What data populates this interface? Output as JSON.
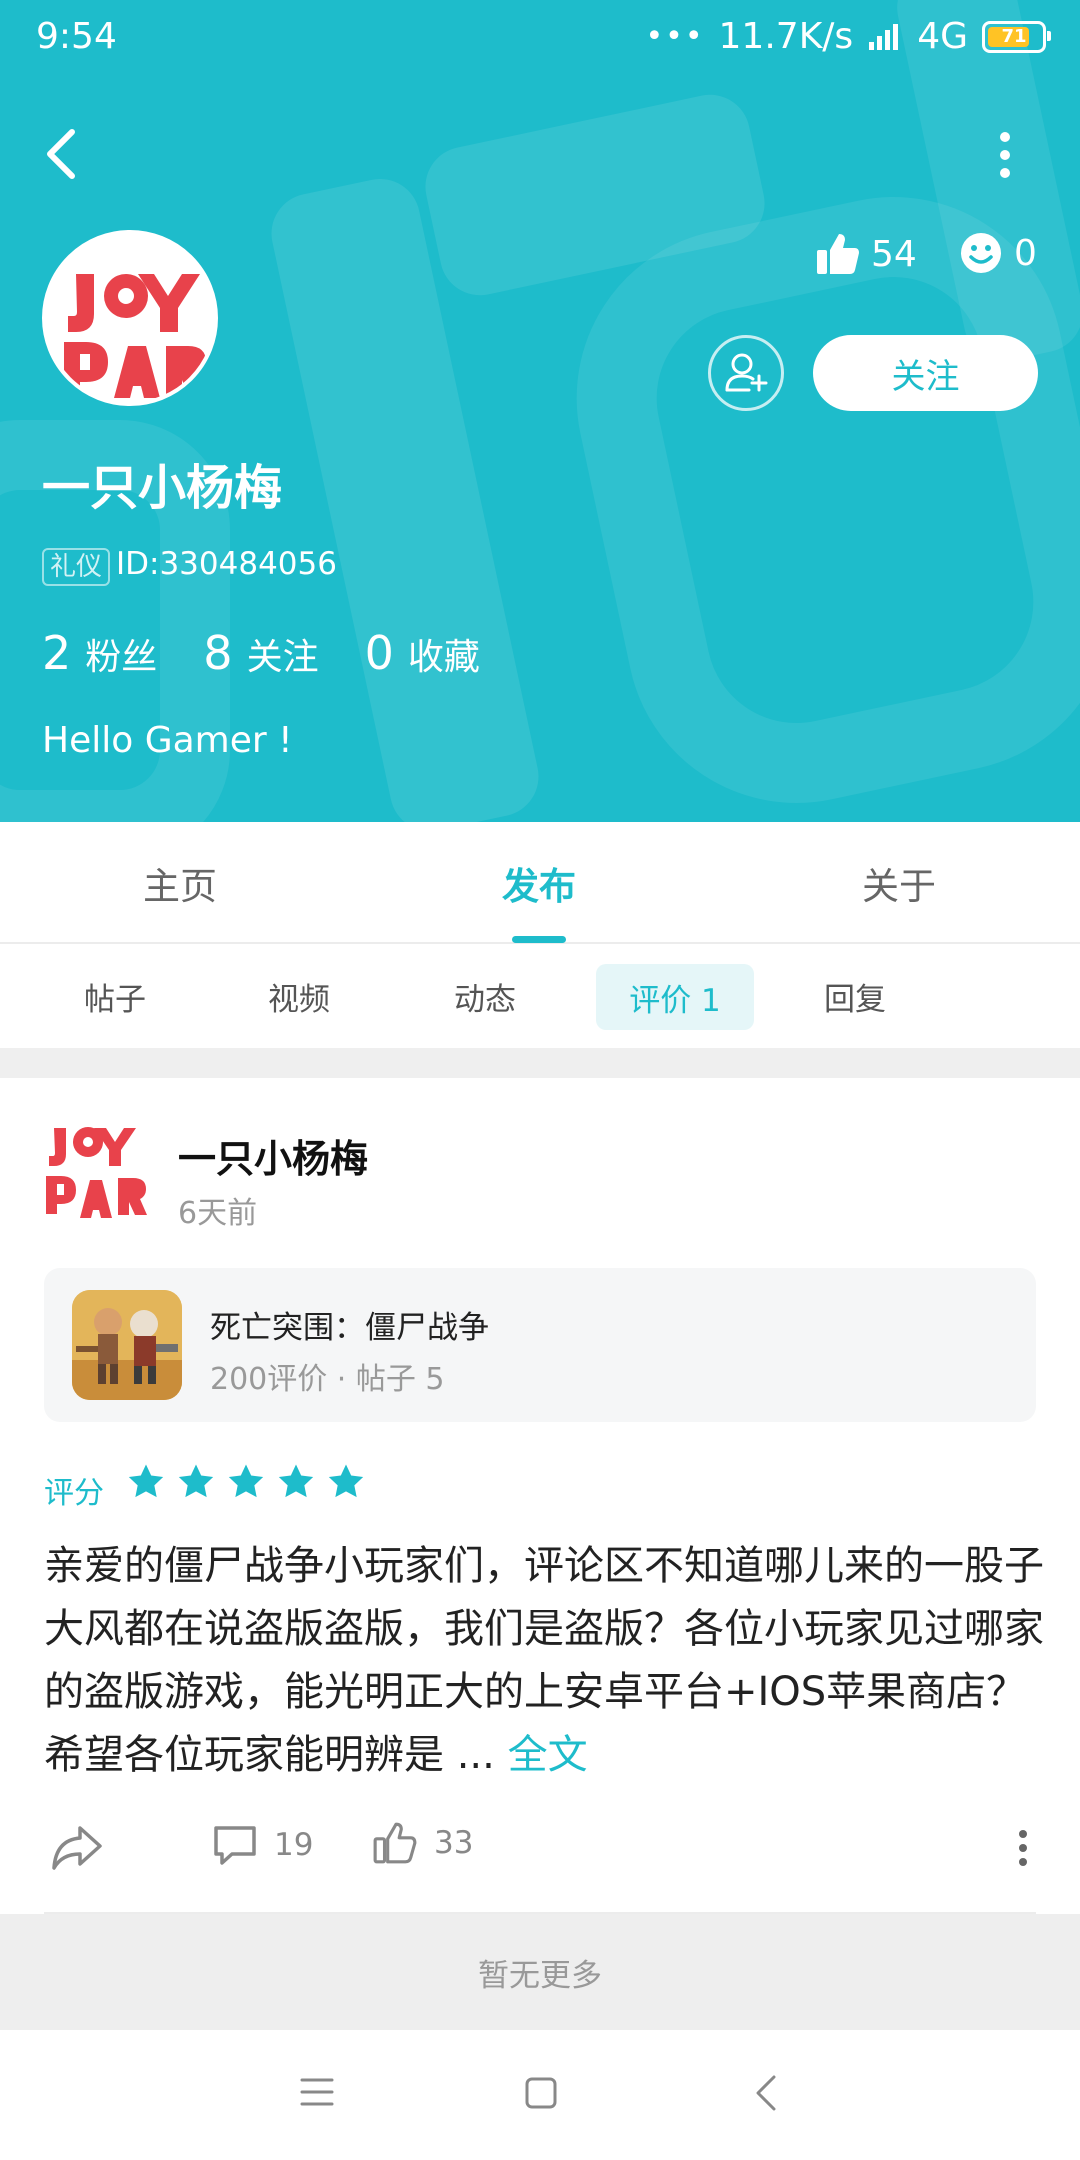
{
  "status_bar": {
    "time": "9:54",
    "network_speed": "11.7K/s",
    "network_type": "4G",
    "battery": "71"
  },
  "profile": {
    "like_count": "54",
    "emoji_count": "0",
    "follow_label": "关注",
    "username": "一只小杨梅",
    "tag": "礼仪",
    "user_id": "ID:330484056",
    "stats": [
      {
        "value": "2",
        "label": "粉丝"
      },
      {
        "value": "8",
        "label": "关注"
      },
      {
        "value": "0",
        "label": "收藏"
      }
    ],
    "bio": "Hello Gamer !"
  },
  "tabs": [
    {
      "label": "主页"
    },
    {
      "label": "发布",
      "active": true
    },
    {
      "label": "关于"
    }
  ],
  "subtabs": [
    {
      "label": "帖子"
    },
    {
      "label": "视频"
    },
    {
      "label": "动态"
    },
    {
      "label": "评价 1",
      "active": true
    },
    {
      "label": "回复"
    }
  ],
  "post": {
    "author": "一只小杨梅",
    "time": "6天前",
    "game": {
      "title": "死亡突围：僵尸战争",
      "meta": "200评价 · 帖子 5"
    },
    "rating_label": "评分",
    "rating": 5,
    "content": "亲爱的僵尸战争小玩家们，评论区不知道哪儿来的一股子大风都在说盗版盗版，我们是盗版？各位小玩家见过哪家的盗版游戏，能光明正大的上安卓平台+IOS苹果商店？希望各位玩家能明辨是 ...",
    "read_more": "全文",
    "comment_count": "19",
    "like_count": "33"
  },
  "footer": {
    "no_more": "暂无更多"
  },
  "colors": {
    "accent": "#1ebccb",
    "avatar_red": "#e8424b"
  }
}
